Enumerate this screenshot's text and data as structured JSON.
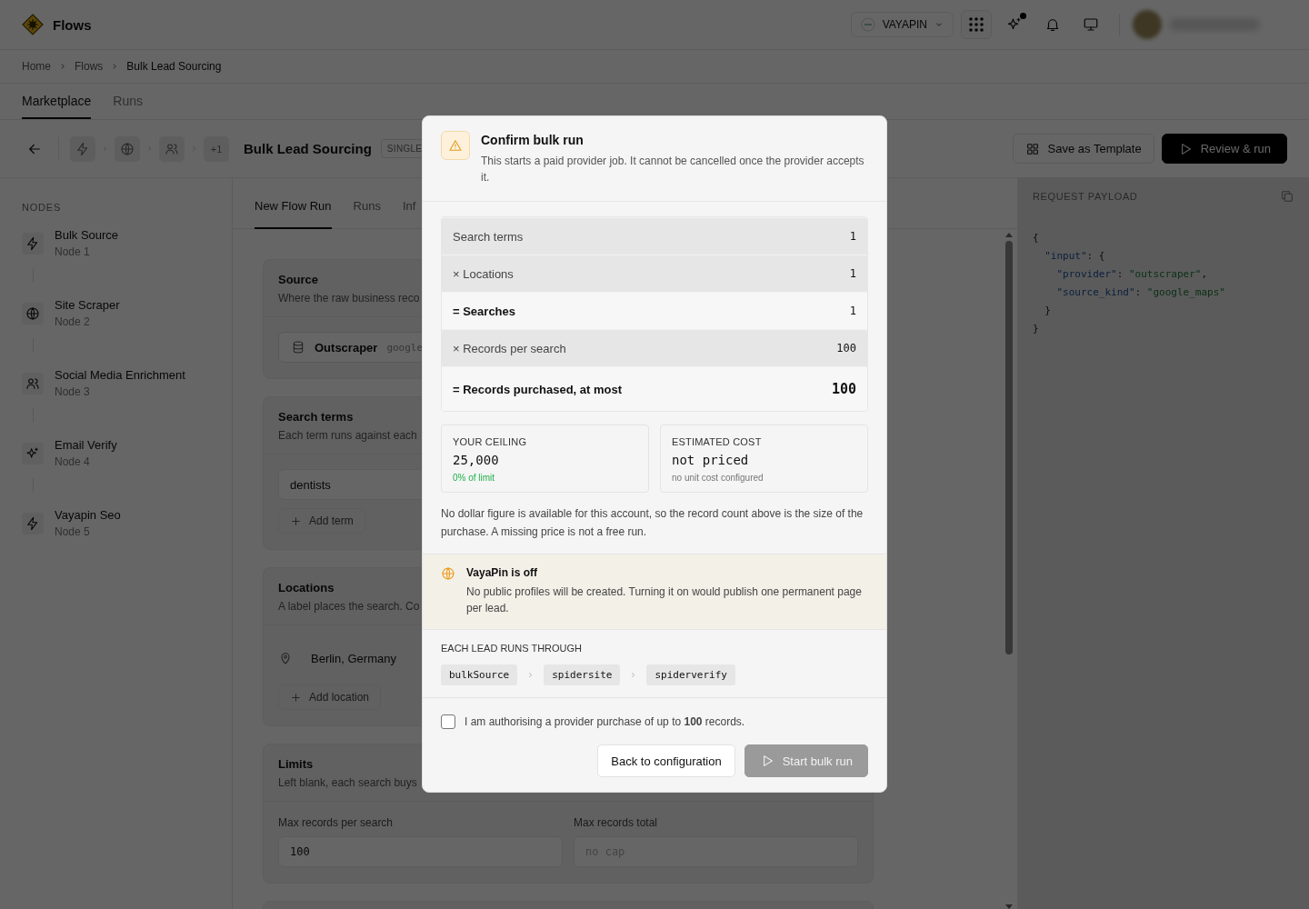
{
  "app": {
    "name": "Flows"
  },
  "header": {
    "workspace": "VAYAPIN",
    "assistant_has_notification": true
  },
  "breadcrumb": [
    {
      "label": "Home"
    },
    {
      "label": "Flows"
    },
    {
      "label": "Bulk Lead Sourcing"
    }
  ],
  "main_tabs": [
    {
      "label": "Marketplace",
      "selected": true
    },
    {
      "label": "Runs",
      "selected": false
    }
  ],
  "toolbar": {
    "chips": [
      {
        "kind": "bolt"
      },
      {
        "kind": "globe"
      },
      {
        "kind": "users"
      },
      {
        "kind": "count",
        "label": "+1"
      }
    ],
    "title": "Bulk Lead Sourcing",
    "badge": "SINGLE",
    "actions": [
      {
        "label": "Save as Template",
        "kind": "secondary"
      },
      {
        "label": "Review & run",
        "kind": "primary"
      }
    ]
  },
  "sidebar": {
    "heading": "NODES",
    "nodes": [
      {
        "kind": "bolt",
        "name": "Bulk Source",
        "sub": "Node 1"
      },
      {
        "kind": "globe",
        "name": "Site Scraper",
        "sub": "Node 2"
      },
      {
        "kind": "users",
        "name": "Social Media Enrichment",
        "sub": "Node 3"
      },
      {
        "kind": "sparkle",
        "name": "Email Verify",
        "sub": "Node 4"
      },
      {
        "kind": "bolt",
        "name": "Vayapin Seo",
        "sub": "Node 5"
      }
    ]
  },
  "flow_tabs": [
    {
      "label": "New Flow Run",
      "selected": true
    },
    {
      "label": "Runs",
      "selected": false
    },
    {
      "label": "Inf",
      "selected": false
    }
  ],
  "sections": [
    {
      "kind": "source",
      "title": "Source",
      "description": "Where the raw business reco",
      "provider": "Outscraper",
      "provider_detail": "google"
    },
    {
      "kind": "terms",
      "title": "Search terms",
      "description": "Each term runs against each",
      "terms": [
        "dentists"
      ],
      "add_label": "Add term"
    },
    {
      "kind": "locations",
      "title": "Locations",
      "description": "A label places the search. Co",
      "locations": [
        "Berlin, Germany"
      ],
      "add_label": "Add location"
    },
    {
      "kind": "limits",
      "title": "Limits",
      "description": "Left blank, each search buys",
      "fields": [
        {
          "label": "Max records per search",
          "value": "100"
        },
        {
          "label": "Max records total",
          "placeholder": "no cap"
        }
      ]
    }
  ],
  "payload": {
    "title": "REQUEST PAYLOAD",
    "lines": [
      [
        {
          "kind": "punct",
          "text": "{"
        }
      ],
      [
        {
          "kind": "key",
          "text": "  \"input\""
        },
        {
          "kind": "punct",
          "text": ": {"
        }
      ],
      [
        {
          "kind": "key",
          "text": "    \"provider\""
        },
        {
          "kind": "punct",
          "text": ": "
        },
        {
          "kind": "string",
          "text": "\"outscraper\""
        },
        {
          "kind": "punct",
          "text": ","
        }
      ],
      [
        {
          "kind": "key",
          "text": "    \"source_kind\""
        },
        {
          "kind": "punct",
          "text": ": "
        },
        {
          "kind": "string",
          "text": "\"google_maps\""
        }
      ],
      [
        {
          "kind": "punct",
          "text": "  }"
        }
      ],
      [
        {
          "kind": "punct",
          "text": "}"
        }
      ]
    ]
  },
  "dialog": {
    "title": "Confirm bulk run",
    "description": "This starts a paid provider job. It cannot be cancelled once the provider accepts it.",
    "breakdown": [
      {
        "kind": "factor",
        "label": "Search terms",
        "value": "1"
      },
      {
        "kind": "factor",
        "label": "× Locations",
        "value": "1"
      },
      {
        "kind": "subtotal",
        "label": "= Searches",
        "value": "1"
      },
      {
        "kind": "factor",
        "label": "× Records per search",
        "value": "100"
      },
      {
        "kind": "total",
        "label": "= Records purchased, at most",
        "value": "100"
      }
    ],
    "stats": [
      {
        "label": "YOUR CEILING",
        "value": "25,000",
        "note": "0% of limit",
        "kind": "good"
      },
      {
        "label": "ESTIMATED COST",
        "value": "not priced",
        "note": "no unit cost configured",
        "kind": "muted"
      }
    ],
    "note": "No dollar figure is available for this account, so the record count above is the size of the purchase. A missing price is not a free run.",
    "notice": {
      "title": "VayaPin is off",
      "body": "No public profiles will be created. Turning it on would publish one permanent page per lead."
    },
    "pipeline_heading": "EACH LEAD RUNS THROUGH",
    "pipeline": [
      "bulkSource",
      "spidersite",
      "spiderverify"
    ],
    "consent": {
      "checked": false,
      "text": "I am authorising a provider purchase of up to **100** records."
    },
    "buttons": [
      {
        "label": "Back to configuration",
        "kind": "secondary",
        "disabled": false
      },
      {
        "label": "Start bulk run",
        "kind": "primary",
        "disabled": true
      }
    ]
  }
}
